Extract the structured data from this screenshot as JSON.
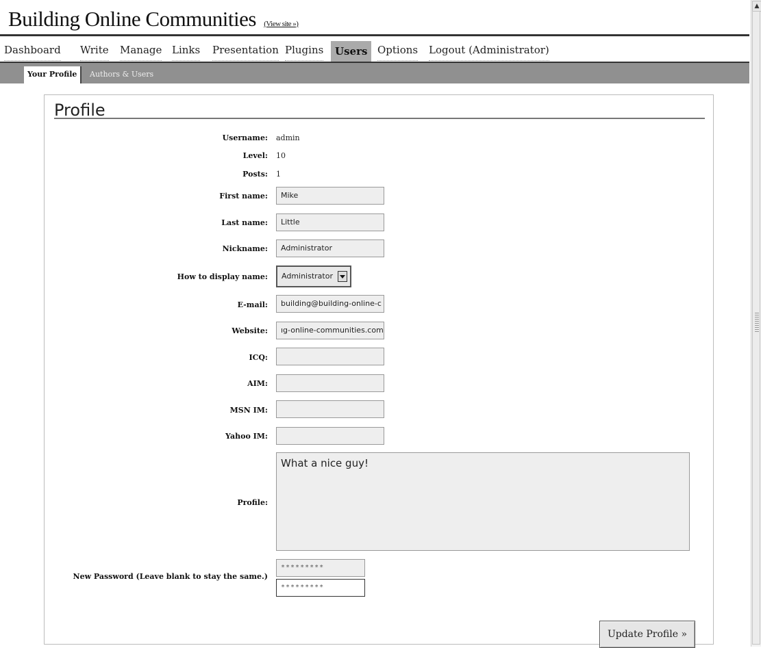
{
  "header": {
    "site_title": "Building Online Communities",
    "view_site": "(View site »)"
  },
  "nav": {
    "items": [
      "Dashboard",
      "Write",
      "Manage",
      "Links",
      "Presentation",
      "Plugins",
      "Users",
      "Options",
      "Logout (Administrator)"
    ],
    "active": "Users"
  },
  "subnav": {
    "active": "Your Profile",
    "link": "Authors & Users"
  },
  "profile": {
    "heading": "Profile",
    "username_label": "Username:",
    "username": "admin",
    "level_label": "Level:",
    "level": "10",
    "posts_label": "Posts:",
    "posts": "1",
    "first_name_label": "First name:",
    "first_name": "Mike",
    "last_name_label": "Last name:",
    "last_name": "Little",
    "nickname_label": "Nickname:",
    "nickname": "Administrator",
    "display_label": "How to display name:",
    "display_value": "Administrator",
    "email_label": "E-mail:",
    "email_visible": "building@building-online-c",
    "website_label": "Website:",
    "website_visible": "ıg-online-communities.com",
    "icq_label": "ICQ:",
    "icq": "",
    "aim_label": "AIM:",
    "aim": "",
    "msn_label": "MSN IM:",
    "msn": "",
    "yahoo_label": "Yahoo IM:",
    "yahoo": "",
    "bio_label": "Profile:",
    "bio": "What a nice guy!",
    "password_label": "New Password (Leave blank to stay the same.)",
    "password1_mask": "*********",
    "password2_mask": "*********",
    "submit_label": "Update Profile »"
  }
}
